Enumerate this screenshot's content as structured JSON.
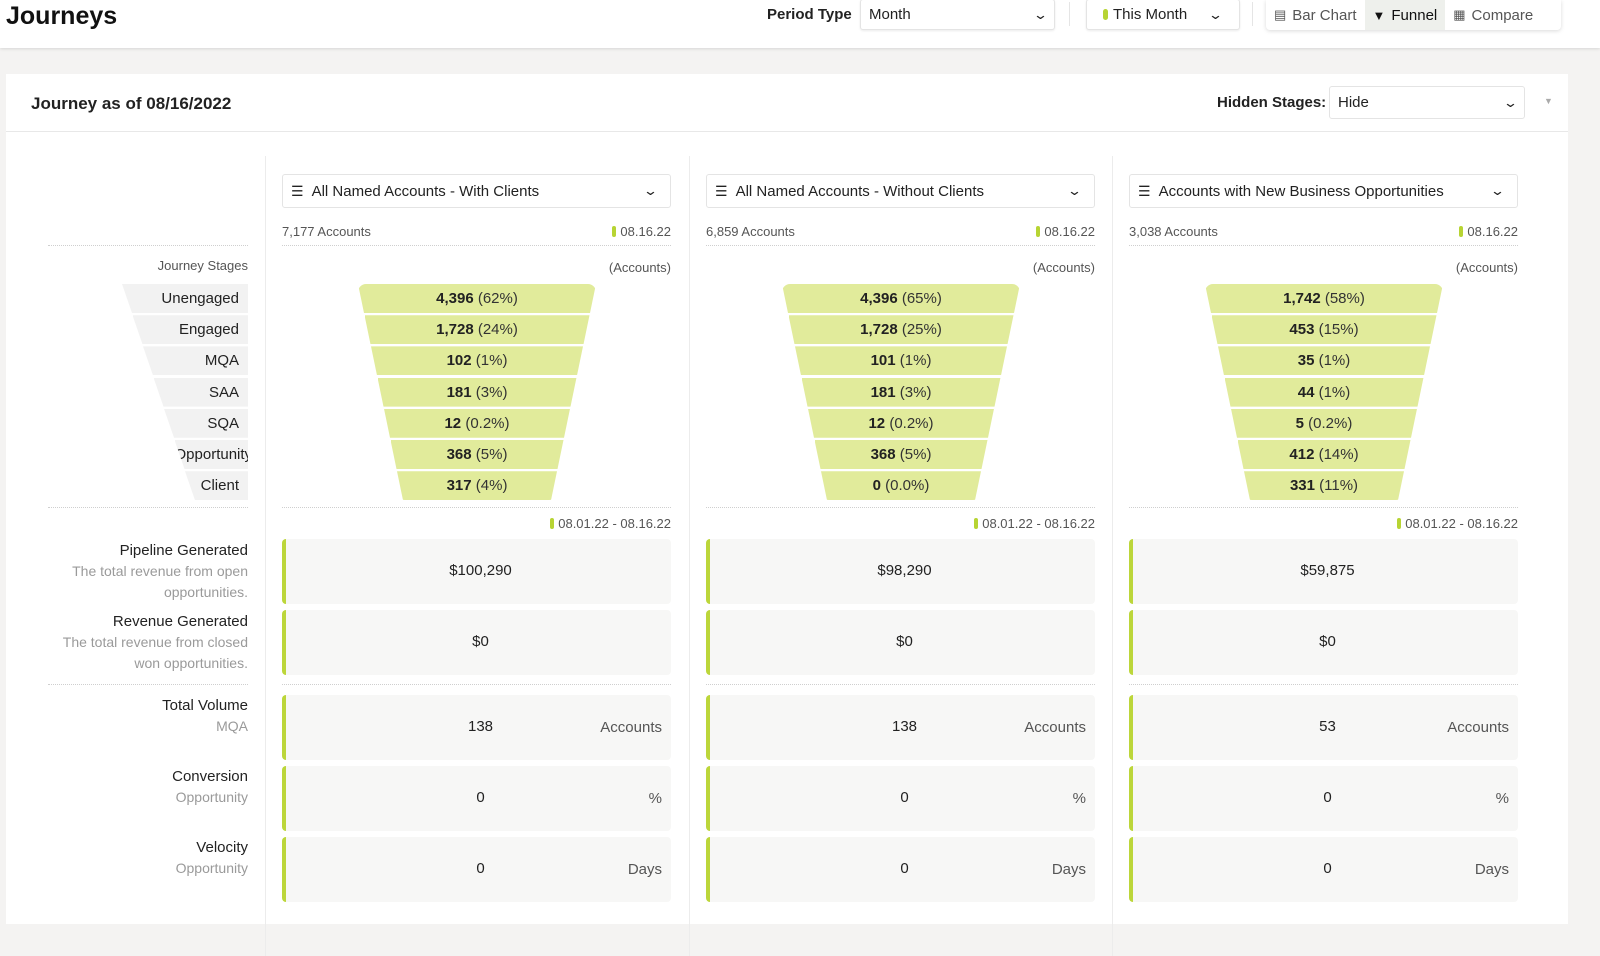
{
  "header": {
    "title": "Journeys",
    "period_type_label": "Period Type",
    "period_type_value": "Month",
    "range_value": "This Month",
    "views": [
      {
        "label": "Bar Chart",
        "icon": "bar-chart-icon",
        "active": false
      },
      {
        "label": "Funnel",
        "icon": "funnel-icon",
        "active": true
      },
      {
        "label": "Compare",
        "icon": "compare-icon",
        "active": false
      }
    ]
  },
  "card": {
    "title": "Journey as of 08/16/2022",
    "hidden_stages_label": "Hidden Stages:",
    "hidden_stages_value": "Hide"
  },
  "labels": {
    "journey_stages": "Journey Stages",
    "stages": [
      "Unengaged",
      "Engaged",
      "MQA",
      "SAA",
      "SQA",
      "Opportunity",
      "Client"
    ],
    "metrics": [
      {
        "title": "Pipeline Generated",
        "sub1": "The total revenue from open",
        "sub2": "opportunities."
      },
      {
        "title": "Revenue Generated",
        "sub1": "The total revenue from closed",
        "sub2": "won opportunities."
      },
      {
        "title": "Total Volume",
        "sub1": "MQA"
      },
      {
        "title": "Conversion",
        "sub1": "Opportunity"
      },
      {
        "title": "Velocity",
        "sub1": "Opportunity"
      }
    ]
  },
  "colors": {
    "accent": "#bcd63a",
    "funnel": "#e1eb9b"
  },
  "columns": [
    {
      "segment": "All Named Accounts - With Clients",
      "count": "7,177 Accounts",
      "as_of": "08.16.22",
      "unit": "(Accounts)",
      "funnel": [
        {
          "value": "4,396",
          "pct": "(62%)"
        },
        {
          "value": "1,728",
          "pct": "(24%)"
        },
        {
          "value": "102",
          "pct": "(1%)"
        },
        {
          "value": "181",
          "pct": "(3%)"
        },
        {
          "value": "12",
          "pct": "(0.2%)"
        },
        {
          "value": "368",
          "pct": "(5%)"
        },
        {
          "value": "317",
          "pct": "(4%)"
        }
      ],
      "date_range": "08.01.22 - 08.16.22",
      "metrics": [
        {
          "value": "$100,290",
          "unit": ""
        },
        {
          "value": "$0",
          "unit": ""
        },
        {
          "value": "138",
          "unit": "Accounts"
        },
        {
          "value": "0",
          "unit": "%"
        },
        {
          "value": "0",
          "unit": "Days"
        }
      ]
    },
    {
      "segment": "All Named Accounts - Without Clients",
      "count": "6,859 Accounts",
      "as_of": "08.16.22",
      "unit": "(Accounts)",
      "funnel": [
        {
          "value": "4,396",
          "pct": "(65%)"
        },
        {
          "value": "1,728",
          "pct": "(25%)"
        },
        {
          "value": "101",
          "pct": "(1%)"
        },
        {
          "value": "181",
          "pct": "(3%)"
        },
        {
          "value": "12",
          "pct": "(0.2%)"
        },
        {
          "value": "368",
          "pct": "(5%)"
        },
        {
          "value": "0",
          "pct": "(0.0%)"
        }
      ],
      "date_range": "08.01.22 - 08.16.22",
      "metrics": [
        {
          "value": "$98,290",
          "unit": ""
        },
        {
          "value": "$0",
          "unit": ""
        },
        {
          "value": "138",
          "unit": "Accounts"
        },
        {
          "value": "0",
          "unit": "%"
        },
        {
          "value": "0",
          "unit": "Days"
        }
      ]
    },
    {
      "segment": "Accounts with New Business Opportunities",
      "count": "3,038 Accounts",
      "as_of": "08.16.22",
      "unit": "(Accounts)",
      "funnel": [
        {
          "value": "1,742",
          "pct": "(58%)"
        },
        {
          "value": "453",
          "pct": "(15%)"
        },
        {
          "value": "35",
          "pct": "(1%)"
        },
        {
          "value": "44",
          "pct": "(1%)"
        },
        {
          "value": "5",
          "pct": "(0.2%)"
        },
        {
          "value": "412",
          "pct": "(14%)"
        },
        {
          "value": "331",
          "pct": "(11%)"
        }
      ],
      "date_range": "08.01.22 - 08.16.22",
      "metrics": [
        {
          "value": "$59,875",
          "unit": ""
        },
        {
          "value": "$0",
          "unit": ""
        },
        {
          "value": "53",
          "unit": "Accounts"
        },
        {
          "value": "0",
          "unit": "%"
        },
        {
          "value": "0",
          "unit": "Days"
        }
      ]
    }
  ]
}
